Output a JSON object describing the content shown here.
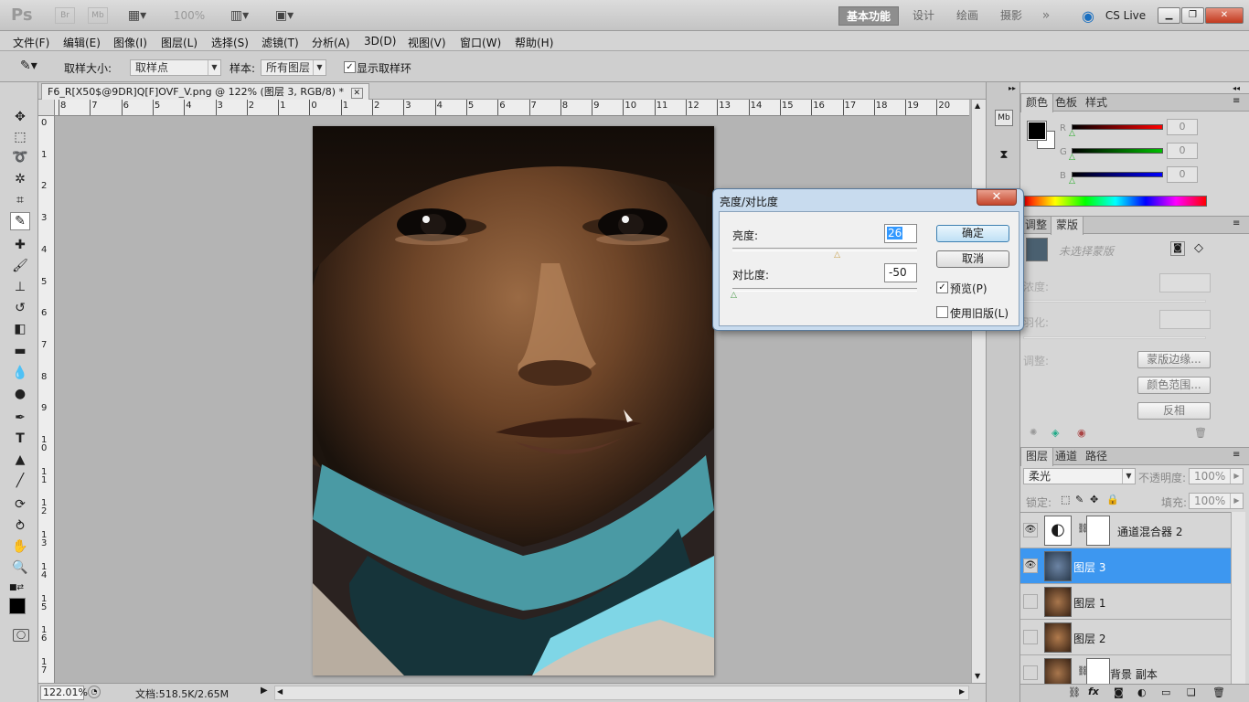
{
  "app": {
    "logo": "Ps",
    "zoom": "100%",
    "workspaces": [
      "基本功能",
      "设计",
      "绘画",
      "摄影"
    ],
    "cs_live": "CS Live",
    "minimize": "▁",
    "restore": "❐",
    "close": "✕"
  },
  "menu": [
    "文件(F)",
    "编辑(E)",
    "图像(I)",
    "图层(L)",
    "选择(S)",
    "滤镜(T)",
    "分析(A)",
    "3D(D)",
    "视图(V)",
    "窗口(W)",
    "帮助(H)"
  ],
  "options": {
    "sample_size_label": "取样大小:",
    "sample_size_value": "取样点",
    "sample_label": "样本:",
    "sample_value": "所有图层",
    "show_ring_label": "显示取样环"
  },
  "document": {
    "tab_title": "F6_R[X50$@9DR]Q[F]OVF_V.png @ 122% (图层 3, RGB/8) *",
    "ruler_h": [
      "8",
      "7",
      "6",
      "5",
      "4",
      "3",
      "2",
      "1",
      "0",
      "1",
      "2",
      "3",
      "4",
      "5",
      "6",
      "7",
      "8",
      "9",
      "10",
      "11",
      "12",
      "13",
      "14",
      "15",
      "16",
      "17",
      "18",
      "19",
      "20"
    ],
    "ruler_v": [
      "0",
      "1",
      "2",
      "3",
      "4",
      "5",
      "6",
      "7",
      "8",
      "9",
      "1 0",
      "1 1",
      "1 2",
      "1 3",
      "1 4",
      "1 5",
      "1 6",
      "1 7"
    ],
    "zoom_status": "122.01%",
    "doc_size": "文档:518.5K/2.65M"
  },
  "dialog": {
    "title": "亮度/对比度",
    "brightness_label": "亮度:",
    "brightness_value": "26",
    "contrast_label": "对比度:",
    "contrast_value": "-50",
    "ok": "确定",
    "cancel": "取消",
    "preview": "预览(P)",
    "legacy": "使用旧版(L)",
    "brightness_fraction": 0.57,
    "contrast_fraction": 0.0
  },
  "color_panel": {
    "tabs": [
      "颜色",
      "色板",
      "样式"
    ],
    "channels": [
      {
        "label": "R",
        "value": "0",
        "color": "#ff0000"
      },
      {
        "label": "G",
        "value": "0",
        "color": "#00c000"
      },
      {
        "label": "B",
        "value": "0",
        "color": "#0000ff"
      }
    ]
  },
  "masks_panel": {
    "tabs": [
      "调整",
      "蒙版"
    ],
    "no_mask": "未选择蒙版",
    "density_label": "浓度:",
    "feather_label": "羽化:",
    "refine_label": "调整:",
    "mask_edge": "蒙版边缘...",
    "color_range": "颜色范围...",
    "invert": "反相"
  },
  "layers_panel": {
    "tabs": [
      "图层",
      "通道",
      "路径"
    ],
    "blend_mode": "柔光",
    "opacity_label": "不透明度:",
    "opacity_value": "100%",
    "lock_label": "锁定:",
    "fill_label": "填充:",
    "fill_value": "100%",
    "layers": [
      {
        "name": "通道混合器 2",
        "visible": true,
        "selected": false
      },
      {
        "name": "图层 3",
        "visible": true,
        "selected": true
      },
      {
        "name": "图层 1",
        "visible": false,
        "selected": false
      },
      {
        "name": "图层 2",
        "visible": false,
        "selected": false
      },
      {
        "name": "背景 副本",
        "visible": false,
        "selected": false
      }
    ]
  }
}
